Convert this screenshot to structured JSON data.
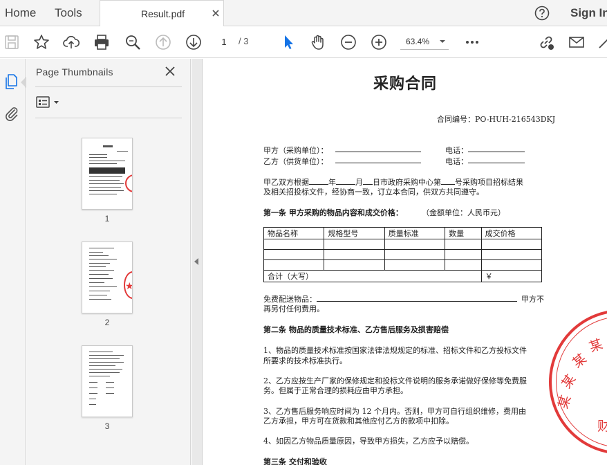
{
  "tabs": {
    "home": "Home",
    "tools": "Tools",
    "document": "Result.pdf"
  },
  "signin": "Sign In",
  "toolbar": {
    "page_current": "1",
    "page_total": "/ 3",
    "zoom": "63.4%"
  },
  "panel": {
    "title": "Page Thumbnails",
    "thumbnails": [
      "1",
      "2",
      "3"
    ]
  },
  "doc": {
    "title": "采购合同",
    "contract_no": "合同编号：PO-HUH-216543DKJ",
    "party_a": "甲方（采购单位）：",
    "party_b": "乙方（供货单位）：",
    "phone": "电话：",
    "para1_l1_a": "甲乙双方根据",
    "para1_l1_b": "年",
    "para1_l1_c": "月",
    "para1_l1_d": "日市政府采购中心第",
    "para1_l1_e": "号采购项目招标结果",
    "para1_l2": "及相关招投标文件，经协商一致，订立本合同，供双方共同遵守。",
    "art1_title": "第一条  甲方采购的物品内容和成交价格：",
    "art1_unit": "（金额单位：人民币元）",
    "table_headers": [
      "物品名称",
      "规格型号",
      "质量标准",
      "数量",
      "成交价格"
    ],
    "table_total_label": "合计（大写）",
    "table_total_symbol": "￥",
    "delivery_l1_a": "免费配送物品：",
    "delivery_l1_b": "甲方不",
    "delivery_l2": "再另付任何费用。",
    "art2_title": "第二条  物品的质量技术标准、乙方售后服务及损害赔偿",
    "item1_l1": "1、物品的质量技术标准按国家法律法规规定的标准、招标文件和乙方投标文件",
    "item1_l2": "所要求的技术标准执行。",
    "item2_l1": "2、乙方应按生产厂家的保修规定和投标文件说明的服务承诺做好保修等免费服",
    "item2_l2": "务。但属于正常合理的损耗应由甲方承担。",
    "item3_l1": "3、乙方售后服务响应时间为 12 个月内。否则，甲方可自行组织维修，费用由",
    "item3_l2": "乙方承担，甲方可在货款和其他应付乙方的款项中扣除。",
    "item4": "4、如因乙方物品质量原因，导致甲方损失，乙方应予以赔偿。",
    "art3_title": "第三条  交付和验收",
    "stamp_chars": [
      "某",
      "某",
      "某",
      "某",
      "财"
    ]
  },
  "colors": {
    "stamp": "#e23a3a",
    "cursor_blue": "#1473e6"
  }
}
